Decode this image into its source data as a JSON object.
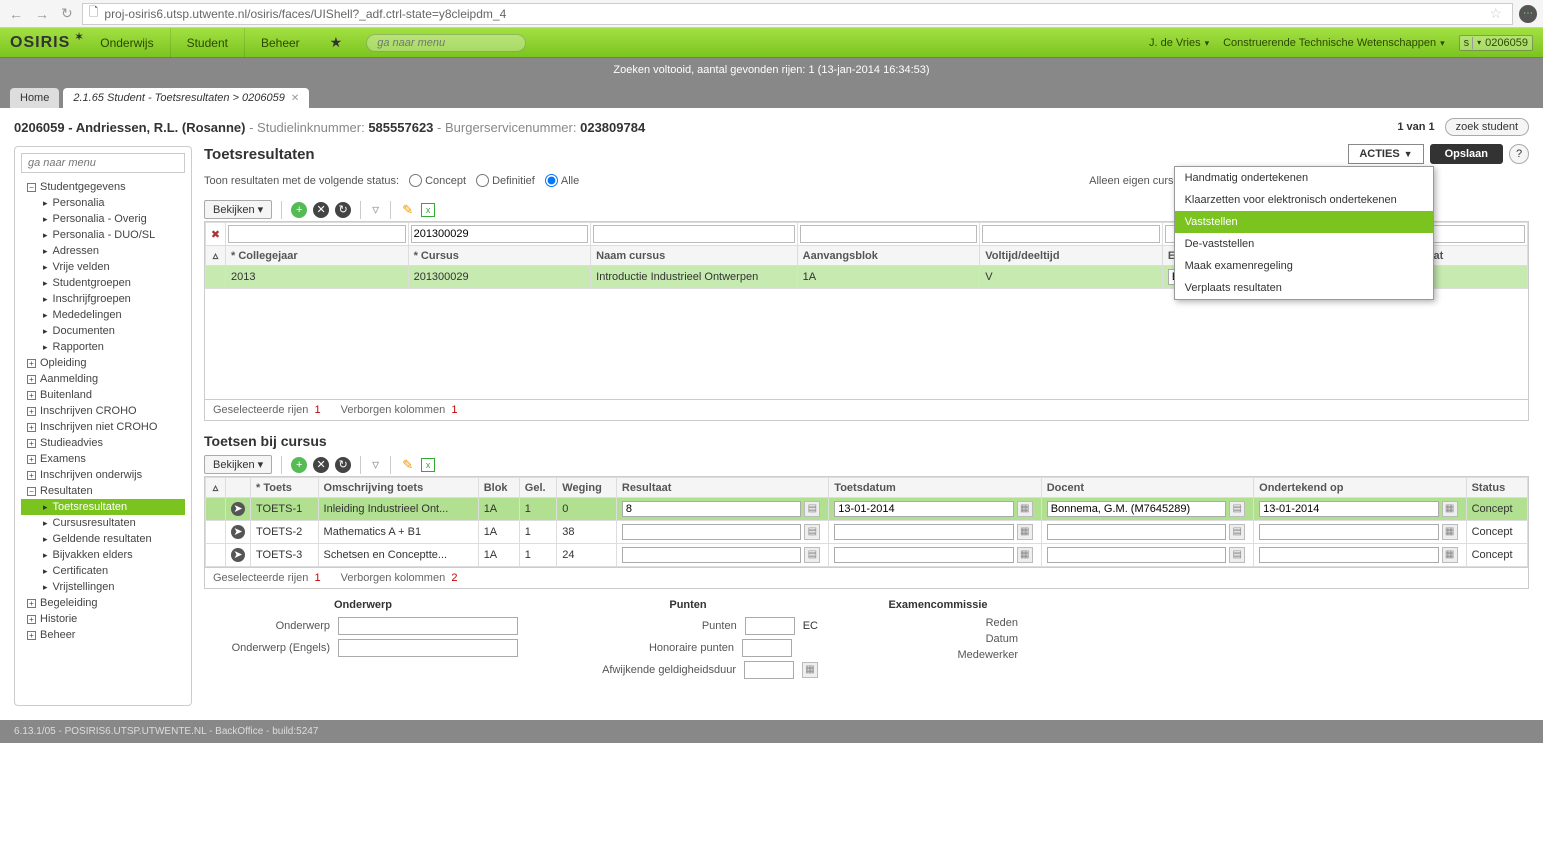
{
  "browser": {
    "url": "proj-osiris6.utsp.utwente.nl/osiris/faces/UIShell?_adf.ctrl-state=y8cleipdm_4"
  },
  "topnav": {
    "logo": "OSIRIS",
    "items": [
      "Onderwijs",
      "Student",
      "Beheer"
    ],
    "search_ph": "ga naar menu",
    "user": "J. de Vries",
    "faculty": "Construerende Technische Wetenschappen",
    "id_prefix": "s",
    "id": "0206059"
  },
  "status": "Zoeken voltooid, aantal gevonden rijen: 1 (13-jan-2014 16:34:53)",
  "tabs": {
    "home": "Home",
    "active": "2.1.65 Student - Toetsresultaten > 0206059"
  },
  "student": {
    "id": "0206059",
    "name": "Andriessen, R.L. (Rosanne)",
    "link_label": "Studielinknummer:",
    "link": "585557623",
    "bsn_label": "Burgerservicenummer:",
    "bsn": "023809784",
    "pager": "1 van 1",
    "zoek": "zoek student"
  },
  "sidebar": {
    "search_ph": "ga naar menu",
    "root1": "Studentgegevens",
    "root1_items": [
      "Personalia",
      "Personalia - Overig",
      "Personalia - DUO/SL",
      "Adressen",
      "Vrije velden",
      "Studentgroepen",
      "Inschrijfgroepen",
      "Mededelingen",
      "Documenten",
      "Rapporten"
    ],
    "roots": [
      "Opleiding",
      "Aanmelding",
      "Buitenland",
      "Inschrijven CROHO",
      "Inschrijven niet CROHO",
      "Studieadvies",
      "Examens",
      "Inschrijven onderwijs"
    ],
    "resultaten": "Resultaten",
    "res_items": [
      "Toetsresultaten",
      "Cursusresultaten",
      "Geldende resultaten",
      "Bijvakken elders",
      "Certificaten",
      "Vrijstellingen"
    ],
    "roots2": [
      "Begeleiding",
      "Historie",
      "Beheer"
    ]
  },
  "panel": {
    "title": "Toetsresultaten",
    "filter_label": "Toon resultaten met de volgende status:",
    "r1": "Concept",
    "r2": "Definitief",
    "r3": "Alle",
    "own_label": "Alleen eigen cursussen?",
    "acties": "ACTIES",
    "opslaan": "Opslaan",
    "menu": [
      "Handmatig ondertekenen",
      "Klaarzetten voor elektronisch ondertekenen",
      "Vaststellen",
      "De-vaststellen",
      "Maak examenregeling",
      "Verplaats resultaten"
    ]
  },
  "grid1": {
    "bekijken": "Bekijken",
    "cols": [
      "",
      "* Collegejaar",
      "* Cursus",
      "Naam cursus",
      "Aanvangsblok",
      "Voltijd/deeltijd",
      "Examendoel",
      "Geldend resultaat"
    ],
    "filter_cursus": "201300029",
    "row": {
      "jaar": "2013",
      "cursus": "201300029",
      "naam": "Introductie Industrieel Ontwerpen",
      "blok": "1A",
      "vd": "V",
      "doel": "B",
      "res": ""
    },
    "sel_label": "Geselecteerde rijen",
    "sel_n": "1",
    "hid_label": "Verborgen kolommen",
    "hid_n": "1"
  },
  "grid2": {
    "title": "Toetsen bij cursus",
    "bekijken": "Bekijken",
    "cols": [
      "",
      "* Toets",
      "Omschrijving toets",
      "Blok",
      "Gel.",
      "Weging",
      "Resultaat",
      "Toetsdatum",
      "Docent",
      "Ondertekend op",
      "Status"
    ],
    "rows": [
      {
        "t": "TOETS-1",
        "o": "Inleiding Industrieel Ont...",
        "b": "1A",
        "g": "1",
        "w": "0",
        "r": "8",
        "d": "13-01-2014",
        "doc": "Bonnema, G.M. (M7645289)",
        "od": "13-01-2014",
        "s": "Concept"
      },
      {
        "t": "TOETS-2",
        "o": "Mathematics A + B1",
        "b": "1A",
        "g": "1",
        "w": "38",
        "r": "",
        "d": "",
        "doc": "",
        "od": "",
        "s": "Concept"
      },
      {
        "t": "TOETS-3",
        "o": "Schetsen en Conceptte...",
        "b": "1A",
        "g": "1",
        "w": "24",
        "r": "",
        "d": "",
        "doc": "",
        "od": "",
        "s": "Concept"
      }
    ],
    "sel_label": "Geselecteerde rijen",
    "sel_n": "1",
    "hid_label": "Verborgen kolommen",
    "hid_n": "2"
  },
  "form": {
    "h1": "Onderwerp",
    "l1": "Onderwerp",
    "l2": "Onderwerp (Engels)",
    "h2": "Punten",
    "l3": "Punten",
    "l3u": "EC",
    "l4": "Honoraire punten",
    "l5": "Afwijkende geldigheidsduur",
    "h3": "Examencommissie",
    "l6": "Reden",
    "l7": "Datum",
    "l8": "Medewerker"
  },
  "footer": "6.13.1/05 - POSIRIS6.UTSP.UTWENTE.NL - BackOffice - build:5247"
}
